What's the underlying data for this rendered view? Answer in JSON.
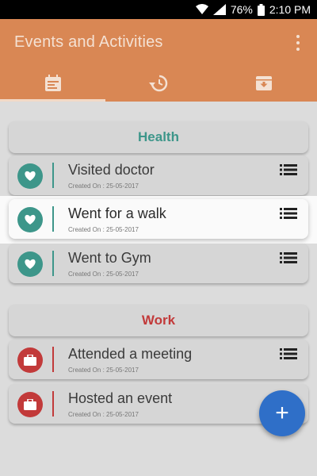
{
  "status_bar": {
    "battery": "76%",
    "time": "2:10 PM"
  },
  "app_bar": {
    "title": "Events and Activities",
    "tabs": [
      {
        "icon": "calendar-icon",
        "active": true
      },
      {
        "icon": "history-icon",
        "active": false
      },
      {
        "icon": "archive-icon",
        "active": false
      }
    ]
  },
  "colors": {
    "app_bar": "#d98754",
    "health": "#3d968a",
    "work": "#c23a3a",
    "fab": "#2f6fc8"
  },
  "sections": {
    "health": {
      "title": "Health",
      "events": [
        {
          "title": "Visited doctor",
          "meta": "Created On : 25-05-2017"
        },
        {
          "title": "Went for a walk",
          "meta": "Created On : 25-05-2017"
        },
        {
          "title": "Went to Gym",
          "meta": "Created On : 25-05-2017"
        }
      ]
    },
    "work": {
      "title": "Work",
      "events": [
        {
          "title": "Attended a meeting",
          "meta": "Created On : 25-05-2017"
        },
        {
          "title": "Hosted an event",
          "meta": "Created On : 25-05-2017"
        }
      ]
    }
  },
  "fab": {
    "label": "+"
  }
}
